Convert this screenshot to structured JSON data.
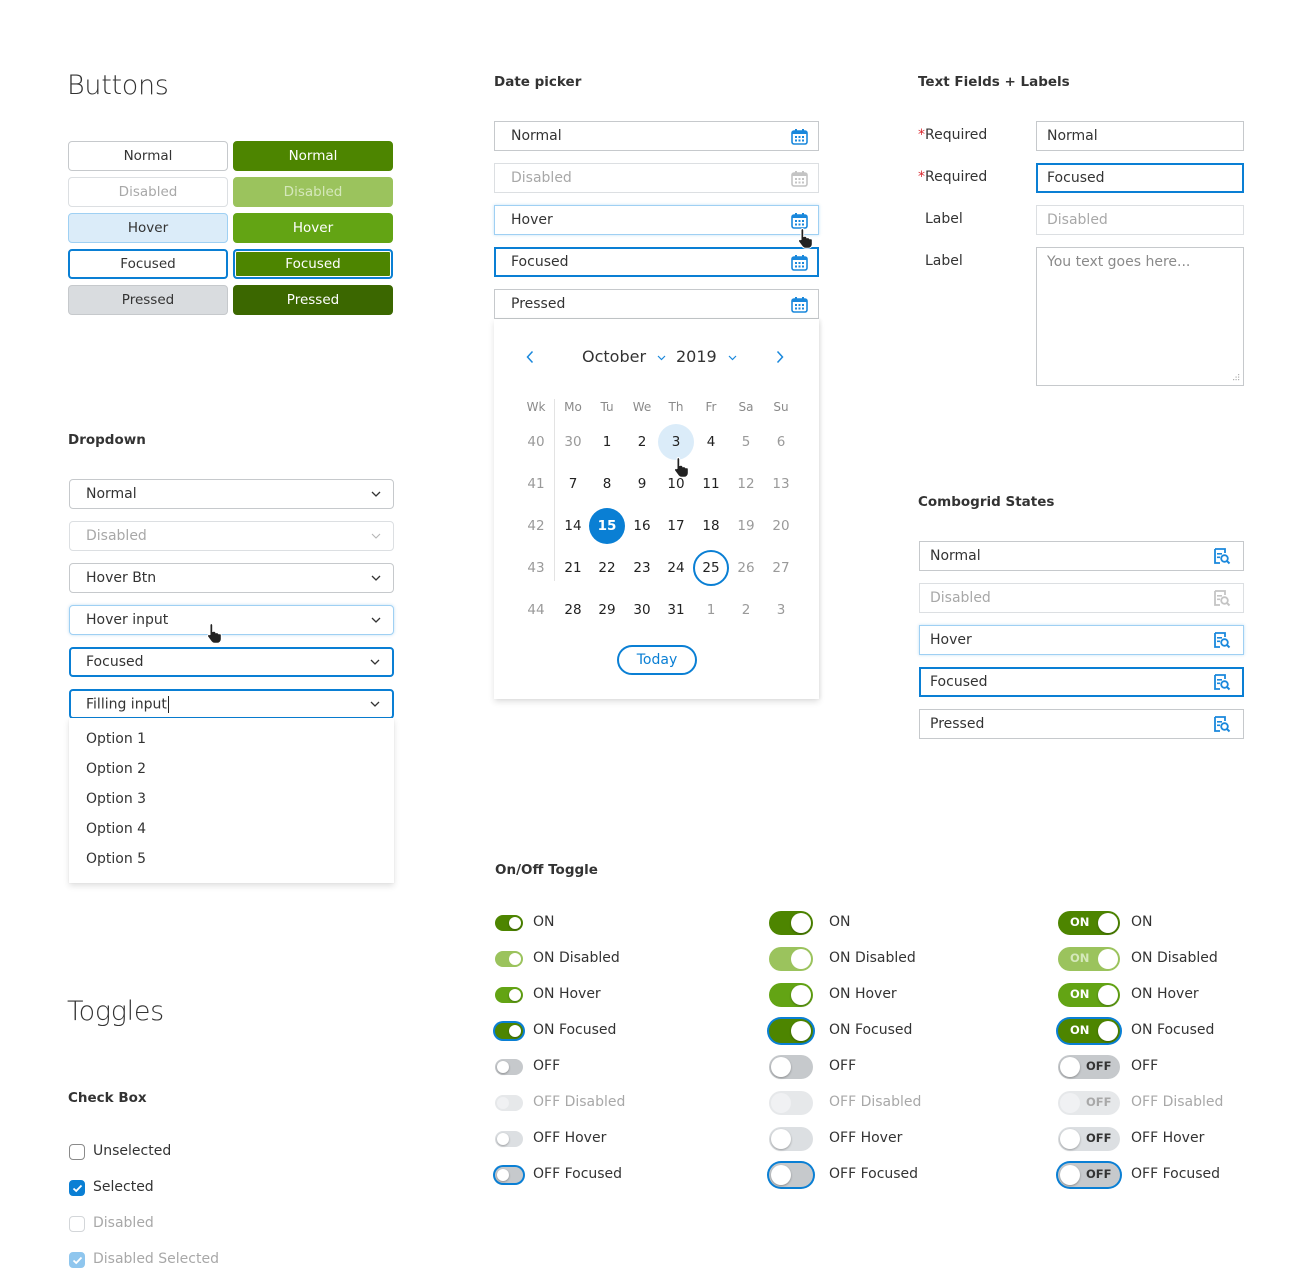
{
  "buttons": {
    "title": "Buttons",
    "secondary": [
      "Normal",
      "Disabled",
      "Hover",
      "Focused",
      "Pressed"
    ],
    "primary": [
      "Normal",
      "Disabled",
      "Hover",
      "Focused",
      "Pressed"
    ]
  },
  "dropdown": {
    "title": "Dropdown",
    "fields": [
      "Normal",
      "Disabled",
      "Hover Btn",
      "Hover input",
      "Focused",
      "Filling input"
    ],
    "options": [
      "Option 1",
      "Option 2",
      "Option 3",
      "Option 4",
      "Option 5"
    ]
  },
  "datepicker": {
    "title": "Date picker",
    "fields": [
      "Normal",
      "Disabled",
      "Hover",
      "Focused",
      "Pressed"
    ],
    "calendar": {
      "month": "October",
      "year": "2019",
      "headers": [
        "Wk",
        "Mo",
        "Tu",
        "We",
        "Th",
        "Fr",
        "Sa",
        "Su"
      ],
      "weeks": [
        {
          "wk": "40",
          "days": [
            "30",
            "1",
            "2",
            "3",
            "4",
            "5",
            "6"
          ]
        },
        {
          "wk": "41",
          "days": [
            "7",
            "8",
            "9",
            "10",
            "11",
            "12",
            "13"
          ]
        },
        {
          "wk": "42",
          "days": [
            "14",
            "15",
            "16",
            "17",
            "18",
            "19",
            "20"
          ]
        },
        {
          "wk": "43",
          "days": [
            "21",
            "22",
            "23",
            "24",
            "25",
            "26",
            "27"
          ]
        },
        {
          "wk": "44",
          "days": [
            "28",
            "29",
            "30",
            "31",
            "1",
            "2",
            "3"
          ]
        }
      ],
      "hovered_day": "3",
      "selected_day": "15",
      "today_day": "25",
      "today_label": "Today"
    }
  },
  "textfields": {
    "title": "Text Fields + Labels",
    "rows": [
      {
        "required": true,
        "label": "Required",
        "value": "Normal"
      },
      {
        "required": true,
        "label": "Required",
        "value": "Focused"
      },
      {
        "required": false,
        "label": "Label",
        "value": "Disabled"
      },
      {
        "required": false,
        "label": "Label",
        "placeholder": "You text goes here..."
      }
    ],
    "required_mark": "*"
  },
  "combogrid": {
    "title": "Combogrid States",
    "fields": [
      "Normal",
      "Disabled",
      "Hover",
      "Focused",
      "Pressed"
    ]
  },
  "toggles": {
    "title": "Toggles",
    "onoff_title": "On/Off Toggle",
    "labels": [
      "ON",
      "ON Disabled",
      "ON Hover",
      "ON Focused",
      "OFF",
      "OFF Disabled",
      "OFF Hover",
      "OFF Focused"
    ],
    "on_text": "ON",
    "off_text": "OFF"
  },
  "checkbox": {
    "title": "Check Box",
    "items": [
      "Unselected",
      "Selected",
      "Disabled",
      "Disabled Selected"
    ]
  },
  "colors": {
    "primary_green": "#4d8500",
    "accent_blue": "#0a7fd4",
    "required_red": "#d9272e"
  }
}
